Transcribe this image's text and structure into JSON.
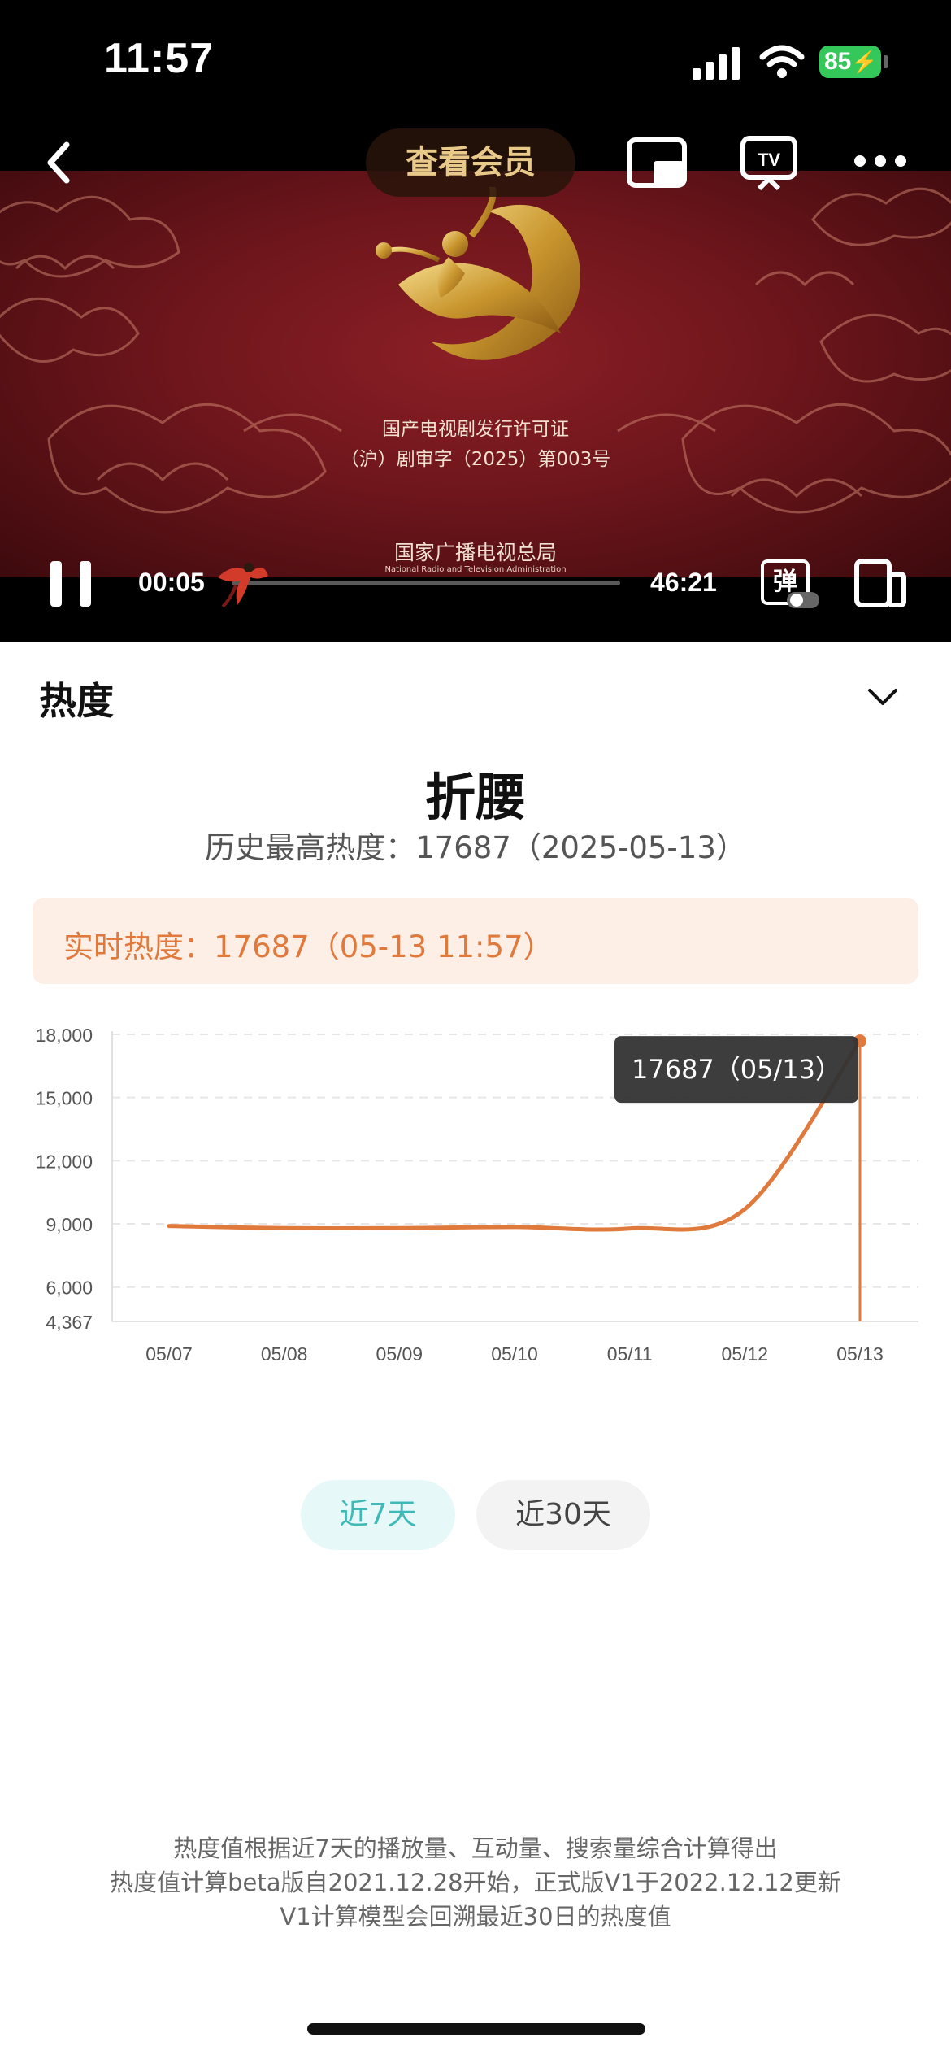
{
  "status_bar": {
    "time": "11:57",
    "battery": "85"
  },
  "player": {
    "vip_label": "查看会员",
    "license_line1": "国产电视剧发行许可证",
    "license_line2": "（沪）剧审字（2025）第003号",
    "authority": "国家广播电视总局",
    "authority_en": "National Radio and Television Administration",
    "time_current": "00:05",
    "time_total": "46:21",
    "danmaku_label": "弹",
    "icons": [
      "back-icon",
      "pip-icon",
      "tv-cast-icon",
      "more-icon",
      "pause-icon",
      "rotate-icon"
    ]
  },
  "heat": {
    "section_title": "热度",
    "show_title": "折腰",
    "history_high": "历史最高热度：17687（2025-05-13）",
    "realtime": "实时热度：17687（05-13 11:57）",
    "accent_color": "#e07a3c"
  },
  "chart_data": {
    "type": "line",
    "x": [
      "05/07",
      "05/08",
      "05/09",
      "05/10",
      "05/11",
      "05/12",
      "05/13"
    ],
    "series": [
      {
        "values": [
          8900,
          8800,
          8800,
          8850,
          8780,
          9700,
          17687
        ]
      }
    ],
    "y_ticks": [
      "18,000",
      "15,000",
      "12,000",
      "9,000",
      "6,000",
      "4,367"
    ],
    "ylim": [
      4367,
      18000
    ],
    "grid": true,
    "tooltip": "17687（05/13）",
    "line_color": "#e07a3c"
  },
  "range_tabs": {
    "tab_7": "近7天",
    "tab_30": "近30天",
    "active": "tab_7"
  },
  "footnotes": {
    "line1": "热度值根据近7天的播放量、互动量、搜索量综合计算得出",
    "line2": "热度值计算beta版自2021.12.28开始，正式版V1于2022.12.12更新",
    "line3": "V1计算模型会回溯最近30日的热度值"
  }
}
